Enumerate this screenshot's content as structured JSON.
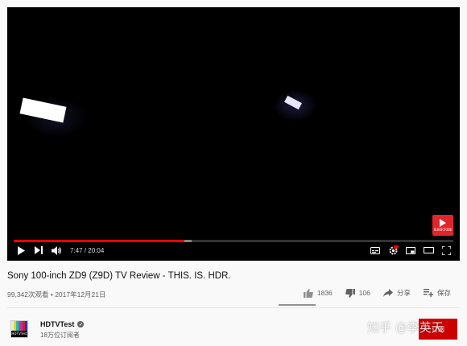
{
  "video": {
    "current_time": "7:47",
    "duration": "20:04",
    "progress_played": 0.388,
    "progress_loaded": 0.405,
    "subscribe_overlay_text": "SUBSCRIBE"
  },
  "info": {
    "title": "Sony 100-inch ZD9 (Z9D) TV Review - THIS. IS. HDR.",
    "meta": "99,342次观看 • 2017年12月21日"
  },
  "actions": {
    "likes": "1836",
    "dislikes": "106",
    "share": "分享",
    "save": "保存"
  },
  "channel": {
    "name": "HDTVTest",
    "subscribers": "18万位订阅者",
    "avatar_label": "HDTVTest",
    "subscribe_label": "订阅"
  },
  "watermark": "知乎 @李英天",
  "colors": {
    "accent": "#ff0000",
    "subscribe": "#cc0000"
  }
}
